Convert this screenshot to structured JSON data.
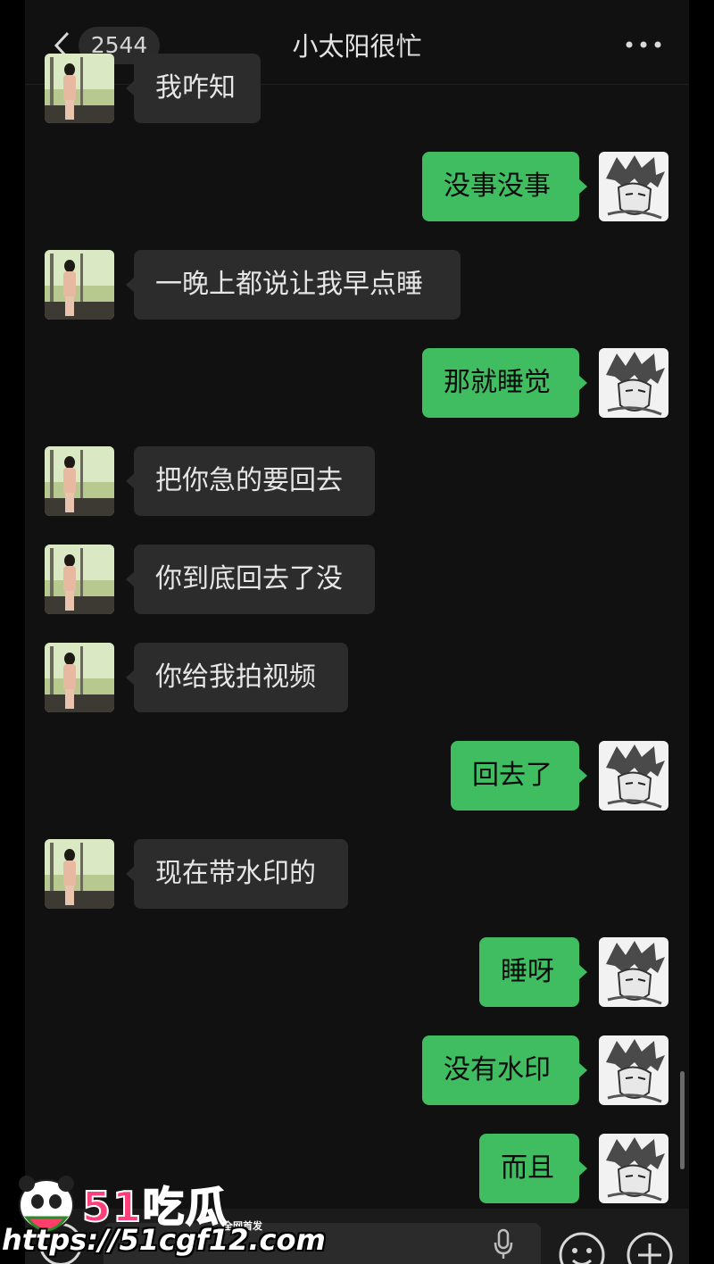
{
  "header": {
    "unread_count": "2544",
    "title": "小太阳很忙"
  },
  "messages": [
    {
      "side": "in",
      "text": "我咋知"
    },
    {
      "side": "out",
      "text": "没事没事"
    },
    {
      "side": "in",
      "text": "一晚上都说让我早点睡"
    },
    {
      "side": "out",
      "text": "那就睡觉"
    },
    {
      "side": "in",
      "text": "把你急的要回去"
    },
    {
      "side": "in",
      "text": "你到底回去了没"
    },
    {
      "side": "in",
      "text": "你给我拍视频"
    },
    {
      "side": "out",
      "text": "回去了"
    },
    {
      "side": "in",
      "text": "现在带水印的"
    },
    {
      "side": "out",
      "text": "睡呀"
    },
    {
      "side": "out",
      "text": "没有水印"
    },
    {
      "side": "out",
      "text": "而且"
    }
  ],
  "watermark": {
    "brand": "51吃瓜",
    "tag": "全网首发",
    "url": "https://51cgf12.com"
  },
  "colors": {
    "background": "#111111",
    "incoming_bubble": "#2c2c2c",
    "outgoing_bubble": "#3fbd60",
    "watermark_pink": "#ff3f7a"
  },
  "icons": [
    "back-chevron-icon",
    "more-dots-icon",
    "voice-icon",
    "mic-icon",
    "emoji-icon",
    "plus-icon"
  ]
}
